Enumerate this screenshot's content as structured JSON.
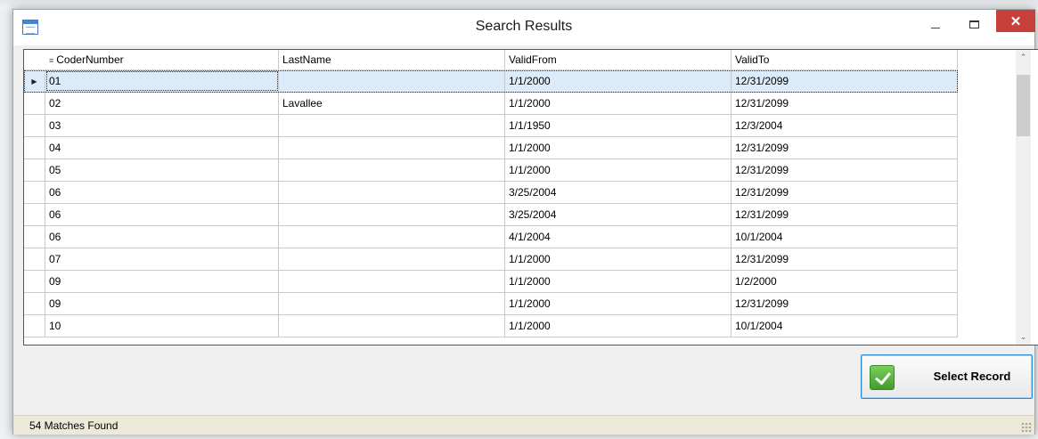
{
  "window": {
    "title": "Search Results",
    "close_glyph": "✕"
  },
  "grid": {
    "columns": [
      "CoderNumber",
      "LastName",
      "ValidFrom",
      "ValidTo"
    ],
    "rows": [
      {
        "coder": "01",
        "last": "",
        "from": "1/1/2000",
        "to": "12/31/2099"
      },
      {
        "coder": "02",
        "last": "Lavallee",
        "from": "1/1/2000",
        "to": "12/31/2099"
      },
      {
        "coder": "03",
        "last": "",
        "from": "1/1/1950",
        "to": "12/3/2004"
      },
      {
        "coder": "04",
        "last": "",
        "from": "1/1/2000",
        "to": "12/31/2099"
      },
      {
        "coder": "05",
        "last": "",
        "from": "1/1/2000",
        "to": "12/31/2099"
      },
      {
        "coder": "06",
        "last": "",
        "from": "3/25/2004",
        "to": "12/31/2099"
      },
      {
        "coder": "06",
        "last": "",
        "from": "3/25/2004",
        "to": "12/31/2099"
      },
      {
        "coder": "06",
        "last": "",
        "from": "4/1/2004",
        "to": "10/1/2004"
      },
      {
        "coder": "07",
        "last": "",
        "from": "1/1/2000",
        "to": "12/31/2099"
      },
      {
        "coder": "09",
        "last": "",
        "from": "1/1/2000",
        "to": "1/2/2000"
      },
      {
        "coder": "09",
        "last": "",
        "from": "1/1/2000",
        "to": "12/31/2099"
      },
      {
        "coder": "10",
        "last": "",
        "from": "1/1/2000",
        "to": "10/1/2004"
      }
    ],
    "selected_row_index": 0,
    "current_row_glyph": "▶"
  },
  "actions": {
    "select_record_label": "Select Record"
  },
  "status": {
    "text": "54 Matches Found"
  },
  "icons": {
    "app": "grid-window-icon",
    "minimize": "minimize-icon",
    "maximize": "maximize-icon",
    "close": "close-icon",
    "select": "checkmark-icon"
  },
  "colors": {
    "close_button": "#c7413a",
    "selected_row": "#dcebfa",
    "check_green": "#4caf35",
    "status_bar": "#ece9d8"
  }
}
